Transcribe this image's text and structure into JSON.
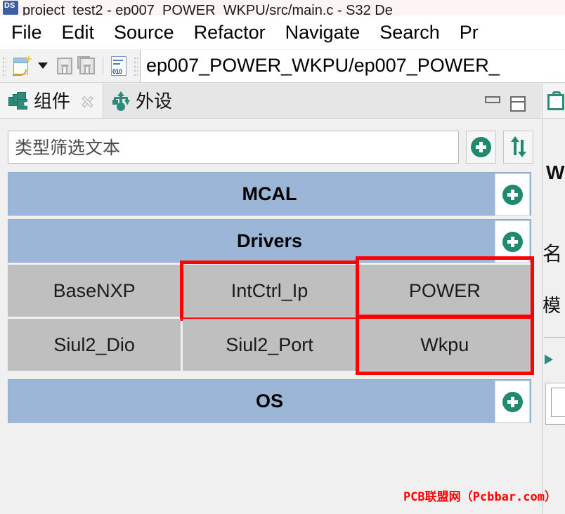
{
  "window": {
    "title": "project_test2 - ep007_POWER_WKPU/src/main.c - S32 De",
    "app_icon": "s32ds-icon"
  },
  "menubar": {
    "items": [
      {
        "label": "File"
      },
      {
        "label": "Edit"
      },
      {
        "label": "Source"
      },
      {
        "label": "Refactor"
      },
      {
        "label": "Navigate"
      },
      {
        "label": "Search"
      },
      {
        "label": "Pr"
      }
    ]
  },
  "toolbar": {
    "path_field_value": "ep007_POWER_WKPU/ep007_POWER_",
    "binary_icon_label": "010"
  },
  "view": {
    "tabs": [
      {
        "label": "组件",
        "icon": "components-icon",
        "active": true,
        "closable": true
      },
      {
        "label": "外设",
        "icon": "usb-peripherals-icon",
        "active": false,
        "closable": false
      }
    ],
    "minimize_tooltip": "",
    "maximize_tooltip": ""
  },
  "filter": {
    "placeholder": "类型筛选文本",
    "value": "类型筛选文本",
    "add_button": "add-icon",
    "sort_button": "sort-icon"
  },
  "tree": {
    "groups": [
      {
        "title": "MCAL",
        "add_label": "+",
        "tiles": []
      },
      {
        "title": "Drivers",
        "add_label": "+",
        "tiles": [
          {
            "label": "BaseNXP",
            "highlighted": false
          },
          {
            "label": "IntCtrl_Ip",
            "highlighted": true
          },
          {
            "label": "POWER",
            "highlighted": true
          },
          {
            "label": "Siul2_Dio",
            "highlighted": false
          },
          {
            "label": "Siul2_Port",
            "highlighted": false
          },
          {
            "label": "Wkpu",
            "highlighted": true
          }
        ]
      },
      {
        "title": "OS",
        "add_label": "+",
        "tiles": []
      }
    ]
  },
  "right_panel": {
    "tab_icon": "properties-clipboard-icon",
    "title": "W",
    "row1": "名",
    "row2": "模"
  },
  "watermark": {
    "text": "PCB联盟网（Pcbbar.com）"
  },
  "colors": {
    "group_header": "#9bb6d7",
    "tile": "#bfbfbf",
    "accent_green": "#1f8a6e",
    "highlight_red": "#ff0000",
    "watermark_red": "#ff0000"
  }
}
